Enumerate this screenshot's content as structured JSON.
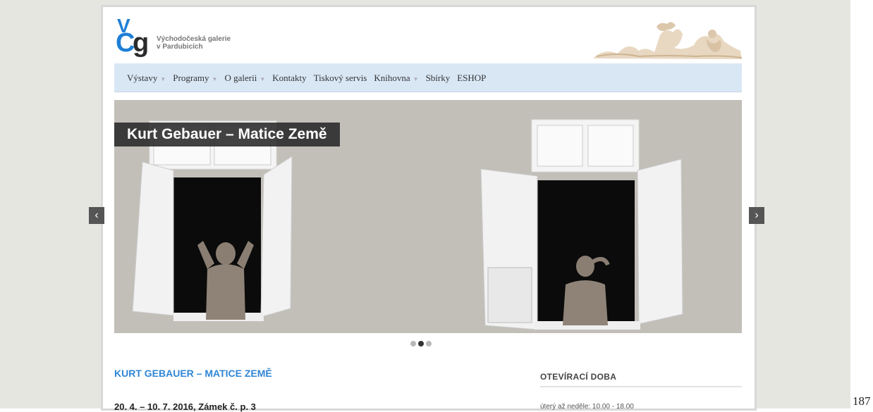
{
  "logo": {
    "letters": {
      "v": "V",
      "c": "C",
      "g": "g"
    },
    "line1": "Východočeská galerie",
    "line2": "v Pardubicích"
  },
  "nav": {
    "items": [
      {
        "label": "Výstavy",
        "has_dropdown": true
      },
      {
        "label": "Programy",
        "has_dropdown": true
      },
      {
        "label": "O galerii",
        "has_dropdown": true
      },
      {
        "label": "Kontakty",
        "has_dropdown": false
      },
      {
        "label": "Tiskový servis",
        "has_dropdown": false
      },
      {
        "label": "Knihovna",
        "has_dropdown": true
      },
      {
        "label": "Sbírky",
        "has_dropdown": false
      },
      {
        "label": "ESHOP",
        "has_dropdown": false
      }
    ],
    "dropdown_glyph": "▼"
  },
  "slider": {
    "caption": "Kurt Gebauer – Matice Země",
    "prev_glyph": "‹",
    "next_glyph": "›",
    "slide_count": 3,
    "active_slide": 2
  },
  "article": {
    "title": "KURT GEBAUER – MATICE ZEMĚ",
    "date_place": "20. 4. – 10. 7. 2016, Zámek č. p. 3"
  },
  "sidebar": {
    "heading": "OTEVÍRACÍ DOBA",
    "hours": "úterý až neděle: 10.00 - 18.00"
  },
  "page_number": "187",
  "colors": {
    "accent": "#2f86d6",
    "nav_bg": "#d9e7f5",
    "caption_bg": "#282828"
  }
}
